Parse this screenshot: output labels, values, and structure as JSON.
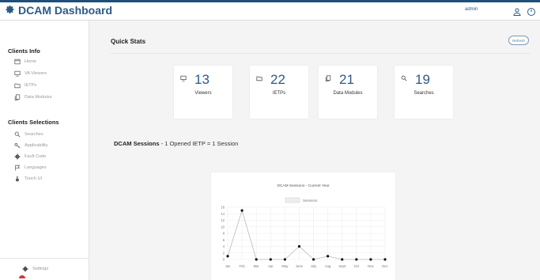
{
  "header": {
    "title": "DCAM Dashboard",
    "user": "admin",
    "brand_icon": "gear-icon",
    "icons": [
      "user-icon",
      "power-icon"
    ],
    "accent": "#1f4f7b"
  },
  "sidebar": {
    "section1": "Clients Info",
    "items1": [
      {
        "label": "Home",
        "icon": "home-icon"
      },
      {
        "label": "VA Viewers",
        "icon": "monitor-icon"
      },
      {
        "label": "IETPs",
        "icon": "folder-icon"
      },
      {
        "label": "Data Modules",
        "icon": "files-icon"
      }
    ],
    "section2": "Clients Selections",
    "items2": [
      {
        "label": "Searches",
        "icon": "search-icon"
      },
      {
        "label": "Applicability",
        "icon": "key-icon"
      },
      {
        "label": "Fault Code",
        "icon": "gear-icon"
      },
      {
        "label": "Languages",
        "icon": "flag-icon"
      },
      {
        "label": "Touch UI",
        "icon": "hand-icon"
      }
    ],
    "settings": "Settings"
  },
  "main": {
    "quick_stats_title": "Quick Stats",
    "refresh_label": "Refresh",
    "cards": [
      {
        "value": "13",
        "label": "Viewers",
        "icon": "monitor-icon"
      },
      {
        "value": "22",
        "label": "IETPs",
        "icon": "folder-icon"
      },
      {
        "value": "21",
        "label": "Data Modules",
        "icon": "files-icon"
      },
      {
        "value": "19",
        "label": "Searches",
        "icon": "search-icon"
      }
    ],
    "sessions_title": "DCAM Sessions",
    "sessions_subtitle": "- 1 Opened IETP = 1 Session"
  },
  "chart_data": {
    "type": "line",
    "title": "DCAM Sessions - Current Year",
    "categories": [
      "Jan",
      "Feb",
      "Mar",
      "Apr",
      "May",
      "June",
      "July",
      "Aug",
      "Sept",
      "Oct",
      "Nov",
      "Dec"
    ],
    "series": [
      {
        "name": "Sessions",
        "values": [
          1,
          15,
          0,
          0,
          0,
          4,
          0,
          1,
          0,
          0,
          0,
          0
        ]
      }
    ],
    "ylim": [
      0,
      16
    ],
    "yticks": [
      0,
      2,
      4,
      6,
      8,
      10,
      12,
      14,
      16
    ],
    "grid": true,
    "legend": "top"
  }
}
